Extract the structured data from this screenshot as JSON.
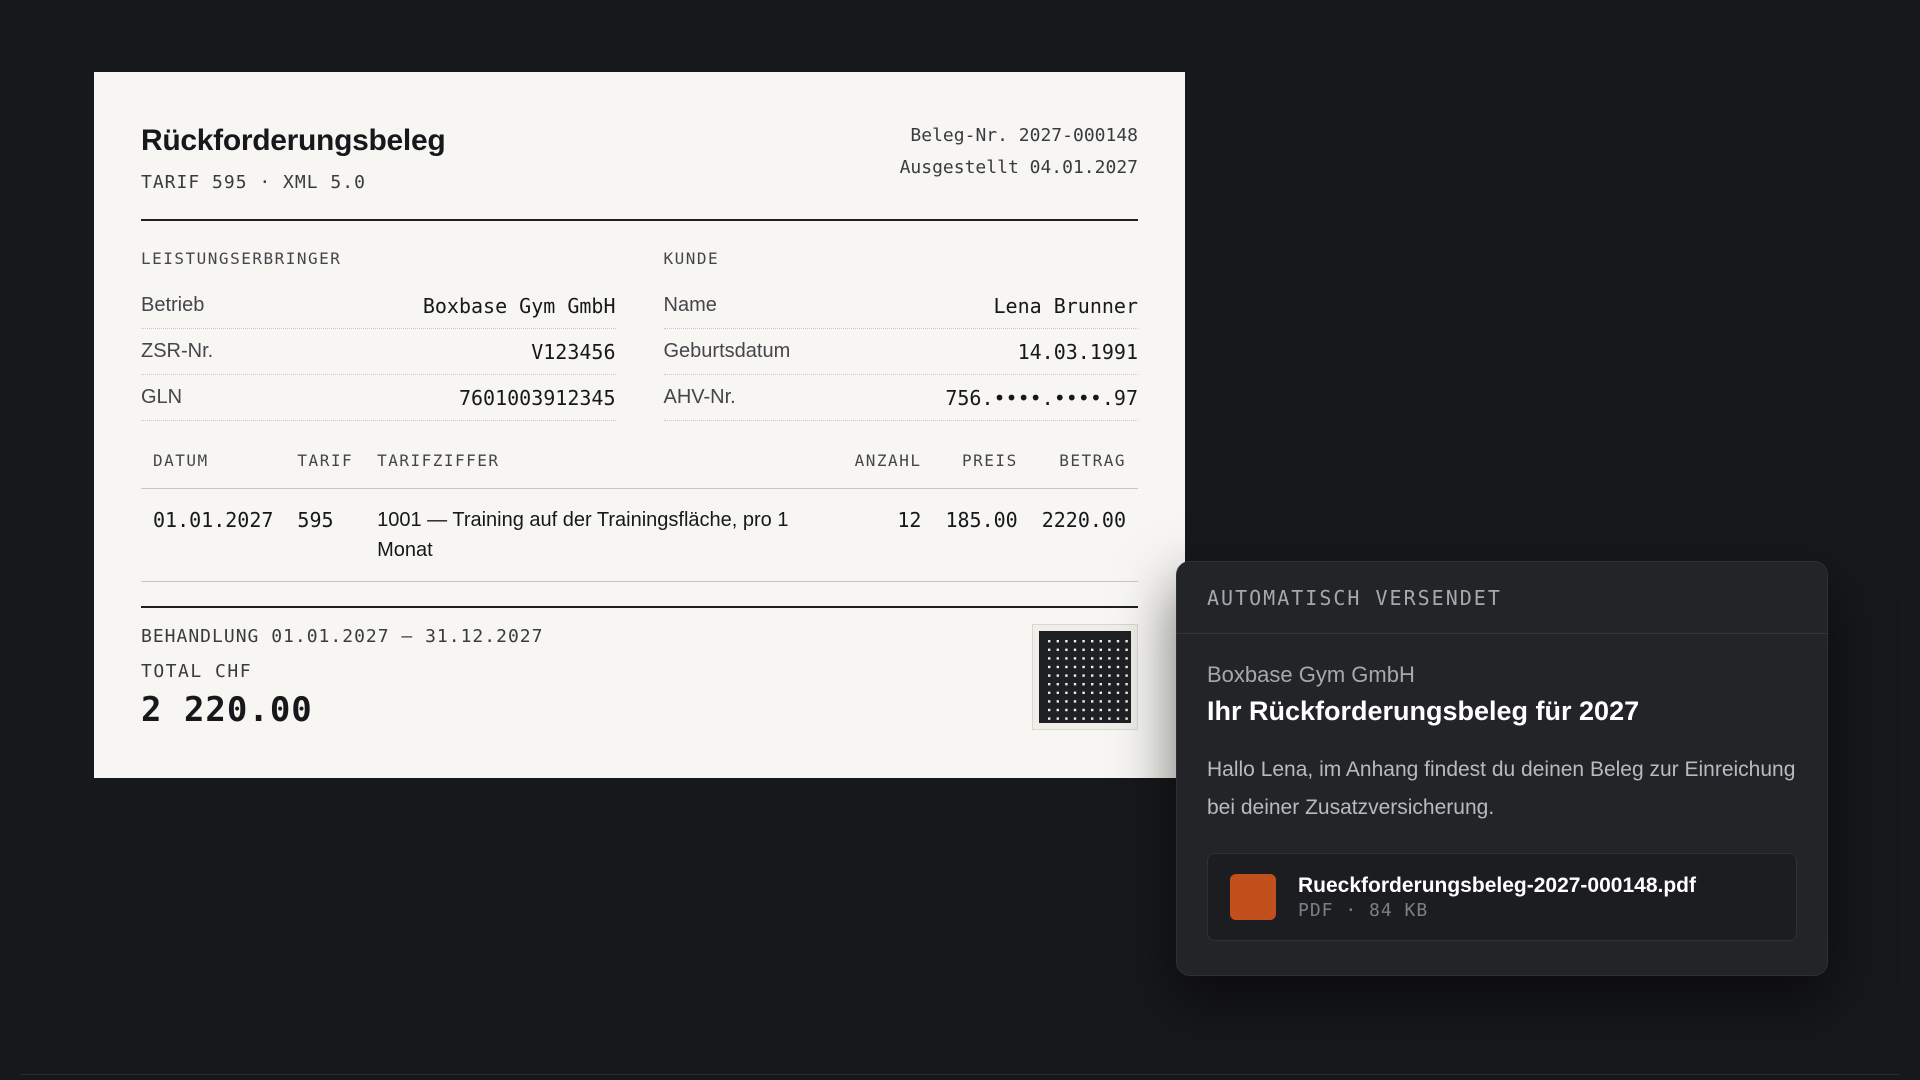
{
  "receipt": {
    "title": "Rückforderungsbeleg",
    "subtitle": "TARIF 595 · XML 5.0",
    "doc_number": "Beleg-Nr. 2027-000148",
    "issued": "Ausgestellt 04.01.2027",
    "provider": {
      "label": "LEISTUNGSERBRINGER",
      "rows": [
        {
          "key": "Betrieb",
          "value": "Boxbase Gym GmbH"
        },
        {
          "key": "ZSR-Nr.",
          "value": "V123456"
        },
        {
          "key": "GLN",
          "value": "7601003912345"
        }
      ]
    },
    "customer": {
      "label": "KUNDE",
      "rows": [
        {
          "key": "Name",
          "value": "Lena Brunner"
        },
        {
          "key": "Geburtsdatum",
          "value": "14.03.1991"
        },
        {
          "key": "AHV-Nr.",
          "value": "756.••••.••••.97"
        }
      ]
    },
    "table": {
      "headers": {
        "datum": "DATUM",
        "tarif": "TARIF",
        "ziffer": "TARIFZIFFER",
        "anzahl": "ANZAHL",
        "preis": "PREIS",
        "betrag": "BETRAG"
      },
      "rows": [
        {
          "datum": "01.01.2027",
          "tarif": "595",
          "ziffer": "1001 — Training auf der Trainingsfläche, pro 1 Monat",
          "anzahl": "12",
          "preis": "185.00",
          "betrag": "2220.00"
        }
      ]
    },
    "period": "BEHANDLUNG 01.01.2027 – 31.12.2027",
    "total_label": "TOTAL CHF",
    "total_value": "2 220.00"
  },
  "notification": {
    "header": "AUTOMATISCH VERSENDET",
    "sender": "Boxbase Gym GmbH",
    "subject": "Ihr Rückforderungsbeleg für 2027",
    "text": "Hallo Lena, im Anhang findest du deinen Beleg zur Einreichung bei deiner Zusatzversicherung.",
    "attachment": {
      "name": "Rueckforderungsbeleg-2027-000148.pdf",
      "meta": "PDF · 84 KB",
      "icon": "pdf-file-icon",
      "icon_color": "#c2501c"
    }
  }
}
